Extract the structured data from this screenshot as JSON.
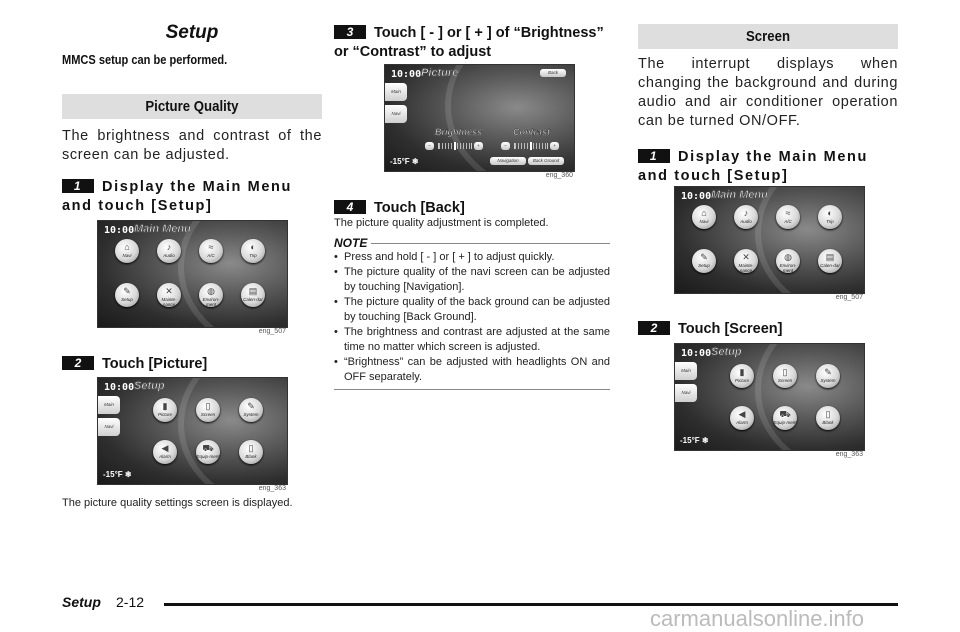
{
  "page": {
    "title": "Setup",
    "subtitle": "MMCS setup can be performed.",
    "footer": {
      "section": "Setup",
      "page_number": "2-12"
    },
    "watermark": "carmanualsonline.info"
  },
  "picture_quality": {
    "heading": "Picture Quality",
    "intro": "The brightness and contrast of the screen can be adjusted.",
    "steps": [
      {
        "num": "1",
        "text": "Display the Main Menu and touch [Setup]",
        "caption": "eng_507"
      },
      {
        "num": "2",
        "text": "Touch [Picture]",
        "caption": "eng_363",
        "after": "The picture quality settings screen is displayed."
      },
      {
        "num": "3",
        "text": "Touch [ - ] or [ + ] of “Brightness” or “Contrast” to adjust",
        "caption": "eng_360"
      },
      {
        "num": "4",
        "text": "Touch [Back]",
        "after": "The picture quality adjustment is completed."
      }
    ],
    "note": {
      "title": "NOTE",
      "items": [
        "Press and hold [ - ] or [ + ] to adjust quickly.",
        "The picture quality of the navi screen can be adjusted by touching [Navigation].",
        "The picture quality of the back ground can be adjusted by touching [Back Ground].",
        "The brightness and contrast are adjusted at the same time no matter which screen is adjusted.",
        "“Brightness” can be adjusted with headlights ON and OFF separately."
      ]
    }
  },
  "screen_section": {
    "heading": "Screen",
    "intro": "The interrupt displays when changing the background and during audio and air conditioner operation can be turned ON/OFF.",
    "steps": [
      {
        "num": "1",
        "text": "Display the Main Menu and touch [Setup]",
        "caption": "eng_507"
      },
      {
        "num": "2",
        "text": "Touch [Screen]",
        "caption": "eng_363"
      }
    ]
  },
  "screens": {
    "clock": "10:00",
    "temperature": "-15°F ❄",
    "main_menu": {
      "title": "Main Menu",
      "buttons": [
        {
          "label": "Navi",
          "icon": "⌂"
        },
        {
          "label": "Audio",
          "icon": "♪"
        },
        {
          "label": "A/C",
          "icon": "≈"
        },
        {
          "label": "Trip",
          "icon": "◐"
        },
        {
          "label": "Setup",
          "icon": "✎"
        },
        {
          "label": "Mainte-nance",
          "icon": "✕"
        },
        {
          "label": "Environ-ment",
          "icon": "◍"
        },
        {
          "label": "Calen-dar",
          "icon": "▤"
        }
      ]
    },
    "setup": {
      "title": "Setup",
      "side": [
        "Main",
        "Navi"
      ],
      "buttons": [
        {
          "label": "Picture",
          "icon": "▮"
        },
        {
          "label": "Screen",
          "icon": "▯"
        },
        {
          "label": "System",
          "icon": "✎"
        },
        {
          "label": "Alarm",
          "icon": "◀"
        },
        {
          "label": "Equip-ment",
          "icon": "⛟"
        },
        {
          "label": "Blank",
          "icon": "▯"
        }
      ]
    },
    "picture": {
      "title": "Picture",
      "side": [
        "Main",
        "Navi"
      ],
      "back": "Back",
      "brightness_label": "Brightness",
      "contrast_label": "Contrast",
      "minus": "−",
      "plus": "+",
      "brightness_level": 0.5,
      "contrast_level": 0.5,
      "navigation": "Navigation",
      "back_ground": "Back Ground"
    }
  }
}
